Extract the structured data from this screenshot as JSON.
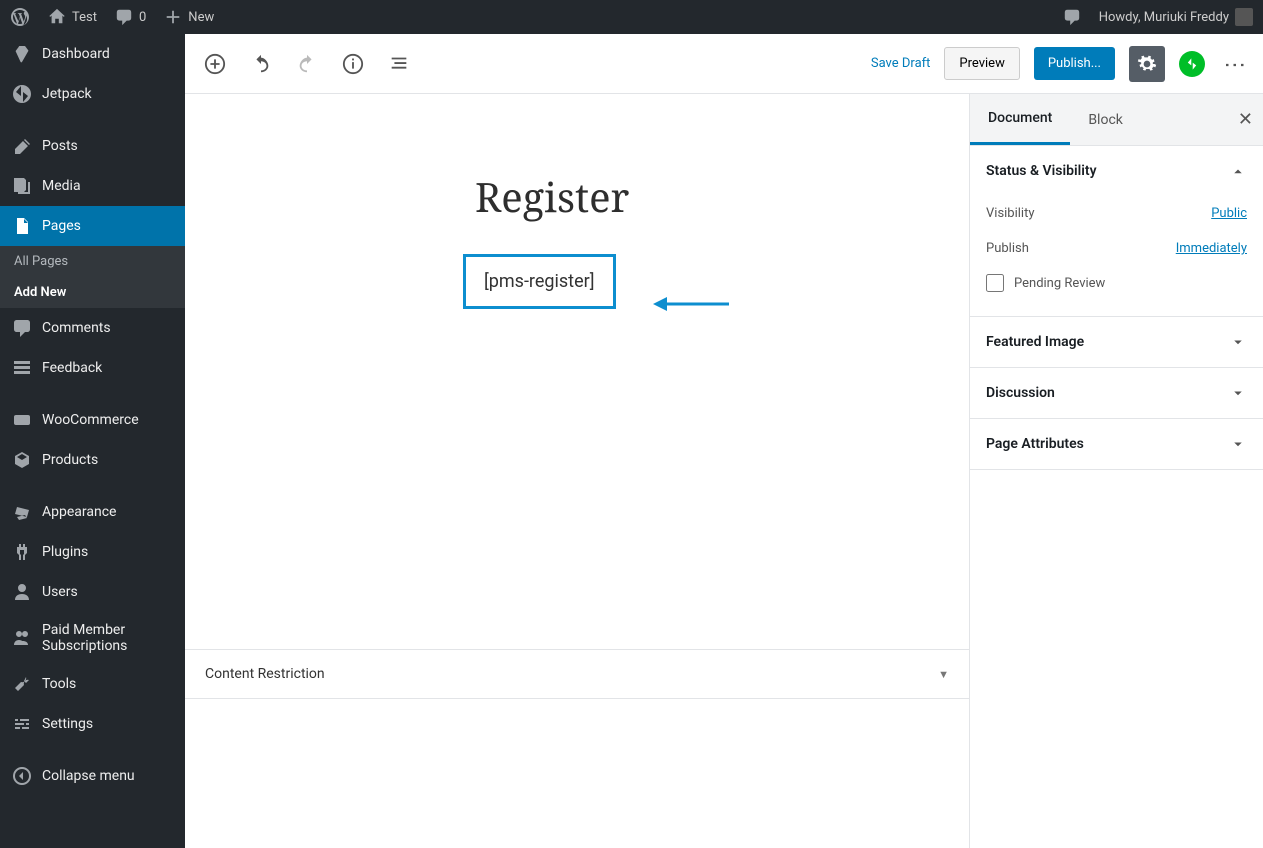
{
  "adminbar": {
    "site": "Test",
    "comments": "0",
    "new": "New",
    "howdy": "Howdy, Muriuki Freddy"
  },
  "sidebar": {
    "dashboard": "Dashboard",
    "jetpack": "Jetpack",
    "posts": "Posts",
    "media": "Media",
    "pages": "Pages",
    "all_pages": "All Pages",
    "add_new": "Add New",
    "comments": "Comments",
    "feedback": "Feedback",
    "woocommerce": "WooCommerce",
    "products": "Products",
    "appearance": "Appearance",
    "plugins": "Plugins",
    "users": "Users",
    "pms": "Paid Member Subscriptions",
    "tools": "Tools",
    "settings": "Settings",
    "collapse": "Collapse menu"
  },
  "toolbar": {
    "save_draft": "Save Draft",
    "preview": "Preview",
    "publish": "Publish..."
  },
  "editor": {
    "title": "Register",
    "block_content": "[pms-register]"
  },
  "metabox": {
    "content_restriction": "Content Restriction"
  },
  "sidepanel": {
    "tabs": {
      "document": "Document",
      "block": "Block"
    },
    "status_visibility": "Status & Visibility",
    "visibility_label": "Visibility",
    "visibility_value": "Public",
    "publish_label": "Publish",
    "publish_value": "Immediately",
    "pending_review": "Pending Review",
    "featured_image": "Featured Image",
    "discussion": "Discussion",
    "page_attributes": "Page Attributes"
  }
}
